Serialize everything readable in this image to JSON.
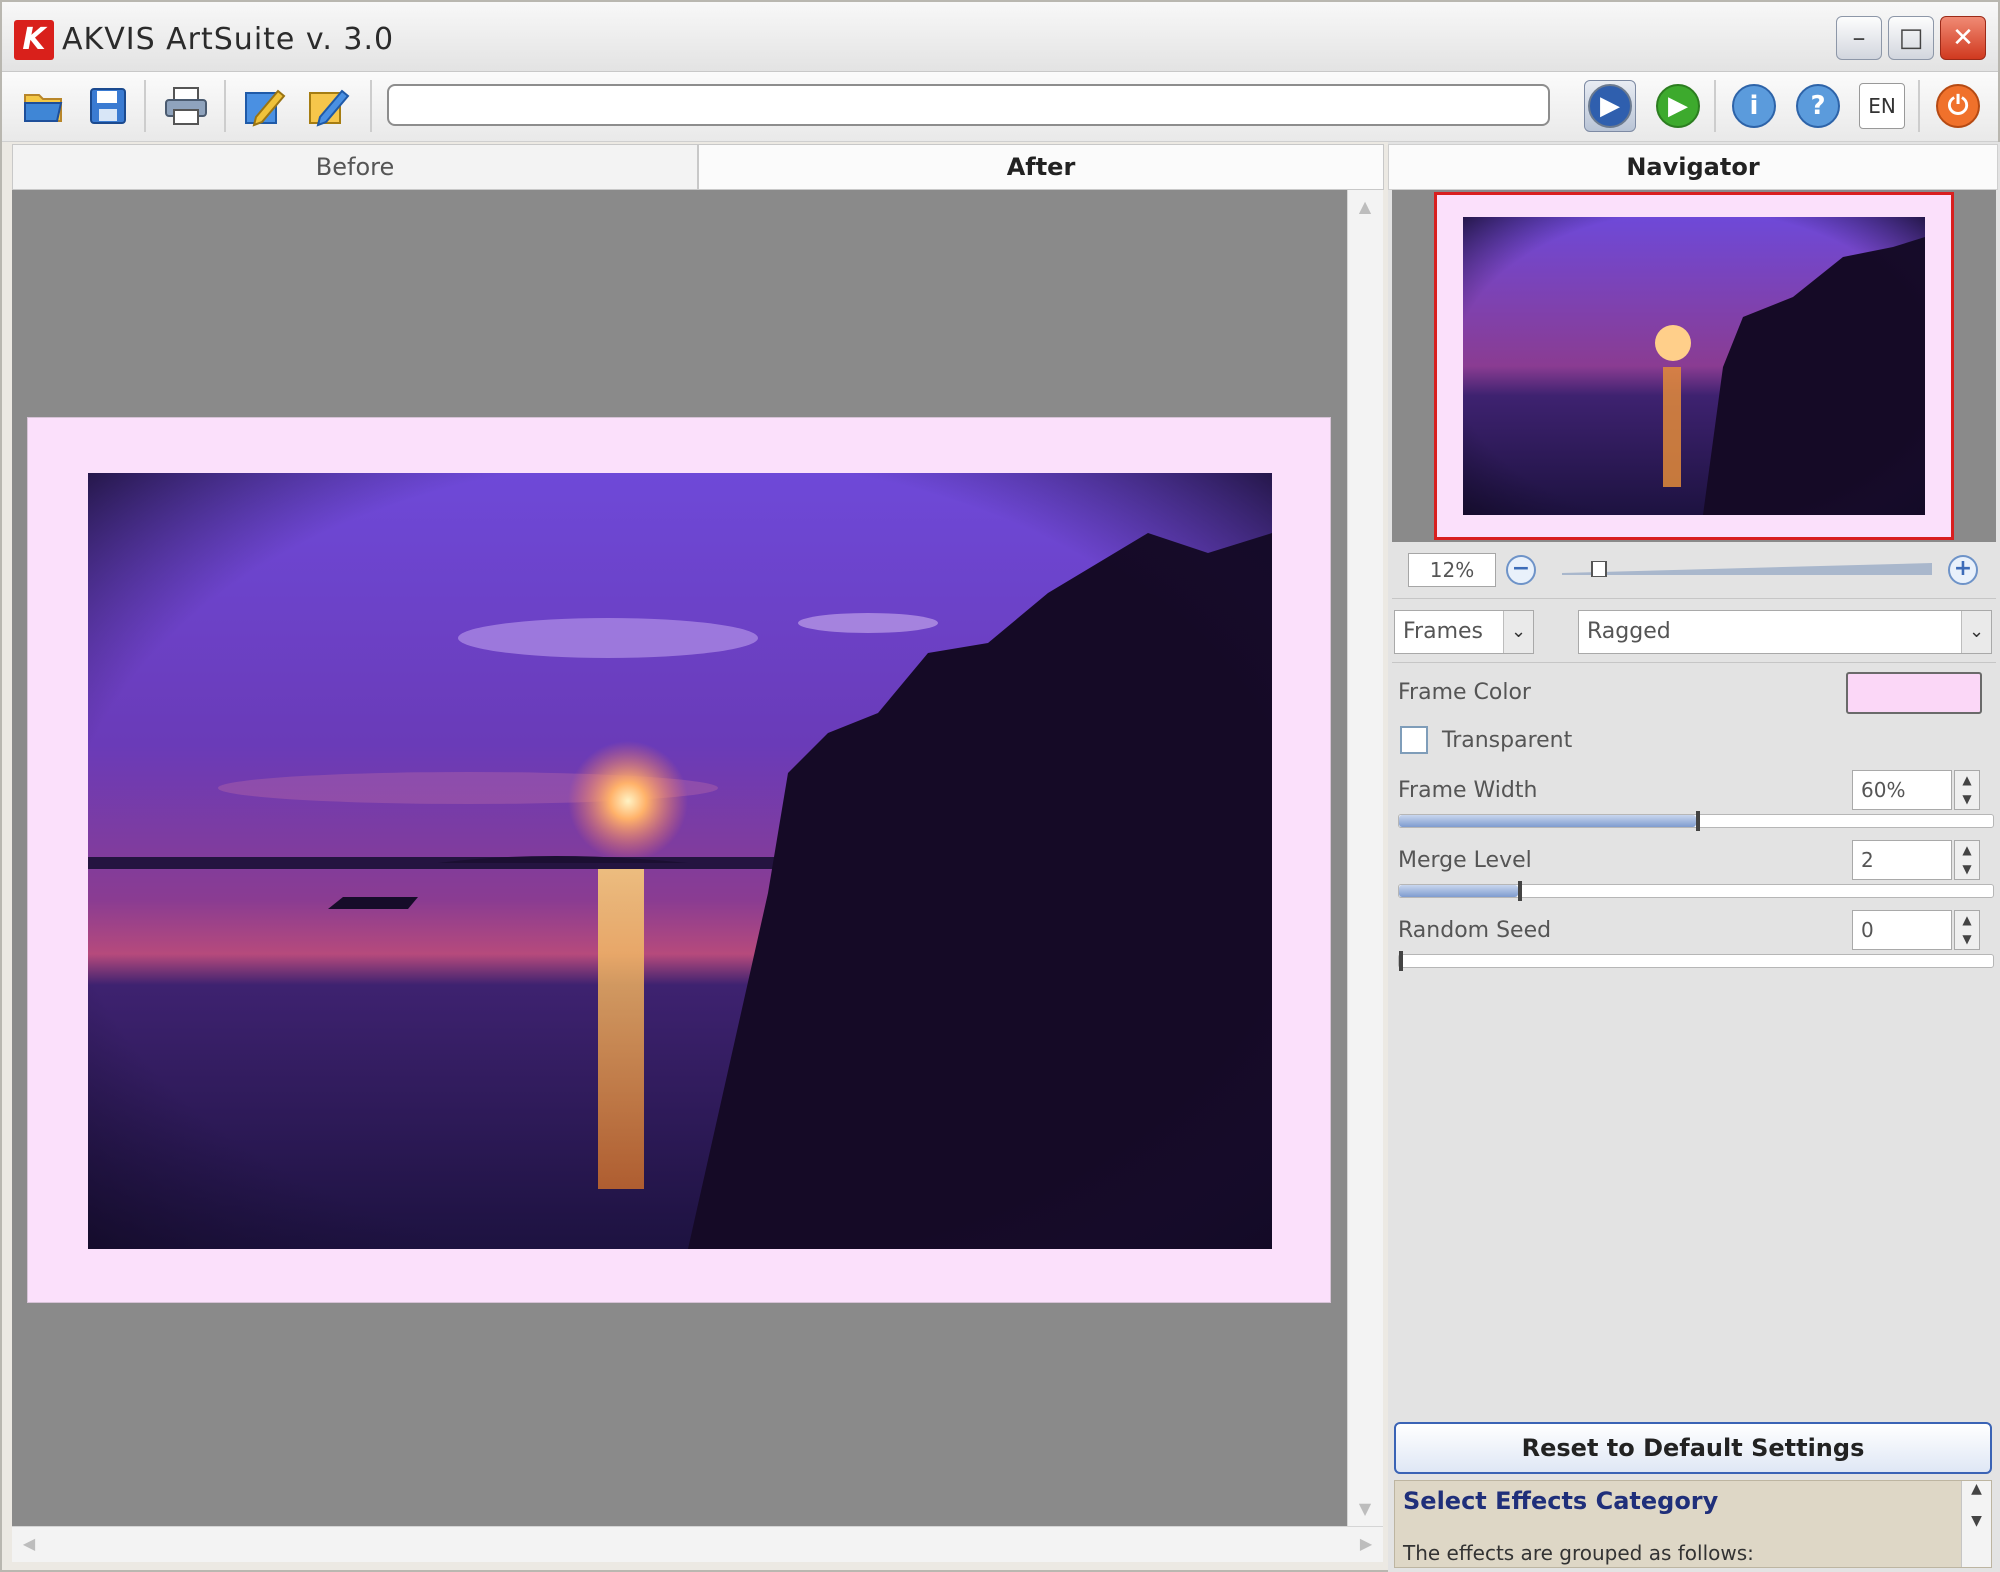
{
  "window": {
    "title": "AKVIS ArtSuite v. 3.0",
    "minimize": "–",
    "maximize": "□",
    "close": "✕"
  },
  "toolbar": {
    "language": "EN",
    "progress_fraction": 0
  },
  "tabs": [
    {
      "label": "Before"
    },
    {
      "label": "After"
    }
  ],
  "navigator": {
    "title": "Navigator",
    "zoom": "12%"
  },
  "effects": {
    "category": "Frames",
    "effect": "Ragged"
  },
  "settings": {
    "frame_color_label": "Frame Color",
    "frame_color": "#fbd7f7",
    "transparent_label": "Transparent",
    "frame_width_label": "Frame Width",
    "frame_width": "60%",
    "merge_level_label": "Merge Level",
    "merge_level": "2",
    "random_seed_label": "Random Seed",
    "random_seed": "0"
  },
  "buttons": {
    "reset": "Reset to Default Settings"
  },
  "help": {
    "title": "Select Effects Category",
    "text": "The effects are grouped as follows:"
  }
}
